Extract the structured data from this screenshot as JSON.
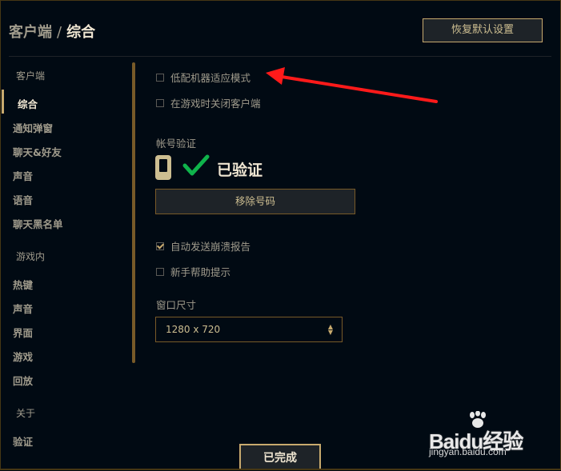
{
  "header": {
    "breadcrumb_parent": "客户端",
    "separator": "/",
    "breadcrumb_current": "综合",
    "reset_button": "恢复默认设置"
  },
  "sidebar": {
    "section_client": "客户端",
    "client_items": [
      "综合",
      "通知弹窗",
      "聊天&好友",
      "声音",
      "语音",
      "聊天黑名单"
    ],
    "section_ingame": "游戏内",
    "ingame_items": [
      "热键",
      "声音",
      "界面",
      "游戏",
      "回放"
    ],
    "section_about": "关于",
    "about_items": [
      "验证"
    ],
    "active_item": "综合"
  },
  "settings": {
    "low_spec_mode": {
      "label": "低配机器适应模式",
      "checked": false
    },
    "close_client_in_game": {
      "label": "在游戏时关闭客户端",
      "checked": false
    },
    "account_verification": {
      "heading": "帐号验证",
      "status": "已验证",
      "remove_button": "移除号码"
    },
    "auto_send_crash": {
      "label": "自动发送崩溃报告",
      "checked": true
    },
    "newbie_tips": {
      "label": "新手帮助提示",
      "checked": false
    },
    "window_size": {
      "heading": "窗口尺寸",
      "value": "1280 x 720"
    }
  },
  "footer": {
    "done_button": "已完成"
  },
  "watermark": {
    "brand": "Baidu经验",
    "url": "jingyan.baidu.com"
  },
  "colors": {
    "background": "#010a13",
    "gold": "#c8aa6e",
    "gold_dark": "#785a28",
    "text": "#a09b8c",
    "text_bright": "#f0e6d2",
    "check_green": "#0fb34b",
    "annotation_arrow": "#ff1a1a"
  },
  "icons": {
    "phone": "phone-icon",
    "verified_check": "check-icon",
    "select_arrows": "updown-chevron-icon"
  }
}
